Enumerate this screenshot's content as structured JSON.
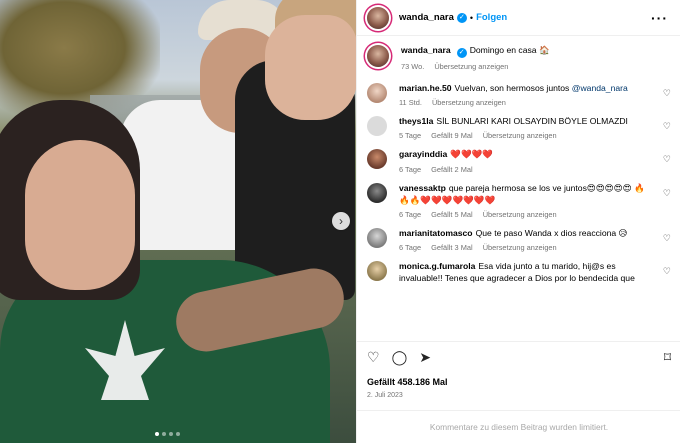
{
  "post": {
    "username": "wanda_nara",
    "follow_label": "Folgen",
    "separator": "•",
    "more_glyph": "···",
    "caption_text": "Domingo en casa 🏠",
    "caption_time": "73 Wo.",
    "translate_label": "Übersetzung anzeigen",
    "likes": "Gefällt 458.186 Mal",
    "date": "2. Juli 2023",
    "comments_limited": "Kommentare zu diesem Beitrag wurden limitiert."
  },
  "comments": [
    {
      "user": "marian.he.50",
      "text": "Vuelvan, son hermosos juntos",
      "mention": "@wanda_nara",
      "time": "11 Std.",
      "likes": "",
      "translate": "Übersetzung anzeigen"
    },
    {
      "user": "theys1la",
      "text": "SİL BUNLARI KARI OLSAYDIN BÖYLE OLMAZDI",
      "mention": "",
      "time": "5 Tage",
      "likes": "Gefällt 9 Mal",
      "translate": "Übersetzung anzeigen"
    },
    {
      "user": "garayinddia",
      "text": "❤️❤️❤️❤️",
      "mention": "",
      "time": "6 Tage",
      "likes": "Gefällt 2 Mal",
      "translate": ""
    },
    {
      "user": "vanessaktp",
      "text": "que pareja hermosa se los ve juntos😍😍😍😍😍 🔥🔥🔥❤️❤️❤️❤️❤️❤️❤️",
      "mention": "",
      "time": "6 Tage",
      "likes": "Gefällt 5 Mal",
      "translate": "Übersetzung anzeigen"
    },
    {
      "user": "marianitatomasco",
      "text": "Que te paso Wanda x dios reacciona 😥",
      "mention": "",
      "time": "6 Tage",
      "likes": "Gefällt 3 Mal",
      "translate": "Übersetzung anzeigen"
    },
    {
      "user": "monica.g.fumarola",
      "text": "Esa vida junto a tu marido, hij@s es invaluable!! Tenes que agradecer a Dios por lo bendecida que",
      "mention": "",
      "time": "",
      "likes": "",
      "translate": ""
    }
  ],
  "icons": {
    "verified": "verified-badge-icon",
    "heart": "heart-icon",
    "comment": "comment-icon",
    "share": "share-icon",
    "save": "bookmark-icon",
    "next": "chevron-right-icon"
  },
  "glyphs": {
    "verified": "✓",
    "heart": "♡",
    "comment": "◯",
    "share": "➤",
    "save": "⌑",
    "next": "›"
  },
  "colors": {
    "accent": "#0095f6",
    "muted": "#737373",
    "border": "#efefef"
  }
}
